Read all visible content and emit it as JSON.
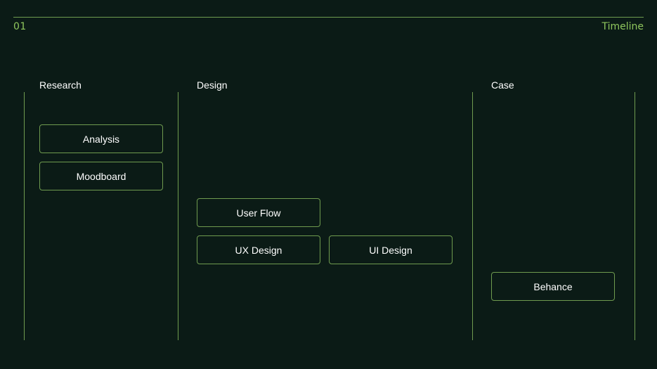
{
  "header": {
    "slide_number": "01",
    "title": "Timeline"
  },
  "columns": {
    "research": {
      "heading": "Research",
      "tasks": [
        "Analysis",
        "Moodboard"
      ]
    },
    "design": {
      "heading": "Design",
      "tasks": [
        "User Flow",
        "UX Design",
        "UI Design"
      ]
    },
    "case": {
      "heading": "Case",
      "tasks": [
        "Behance"
      ]
    }
  },
  "colors": {
    "background": "#0b1b16",
    "accent": "#8fc65d",
    "line": "#6f9b4f",
    "text": "#ffffff"
  }
}
